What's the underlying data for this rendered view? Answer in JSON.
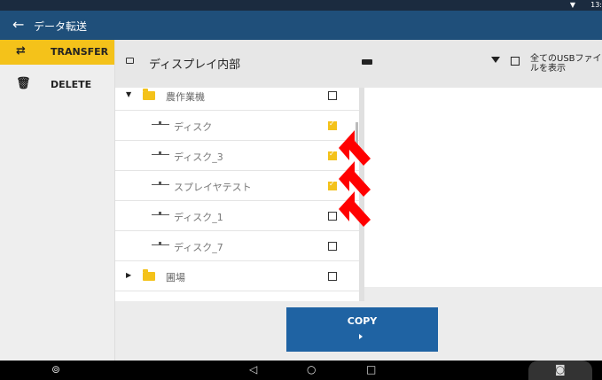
{
  "status": {
    "time": "13:"
  },
  "app": {
    "title": "データ転送"
  },
  "sidebar": {
    "items": [
      {
        "label": "TRANSFER",
        "icon": "swap-arrows-icon"
      },
      {
        "label": "DELETE",
        "icon": "trash-icon"
      }
    ]
  },
  "header": {
    "name": "ディスプレイ内部",
    "usb_label": "全てのUSBファイルを表示"
  },
  "list": {
    "rows": [
      {
        "type": "folder",
        "name": "農作業機",
        "expanded": true,
        "checked": false
      },
      {
        "type": "disk",
        "name": "ディスク",
        "checked": true
      },
      {
        "type": "disk",
        "name": "ディスク_3",
        "checked": true
      },
      {
        "type": "disk",
        "name": "スプレイヤテスト",
        "checked": true
      },
      {
        "type": "disk",
        "name": "ディスク_1",
        "checked": false
      },
      {
        "type": "disk",
        "name": "ディスク_7",
        "checked": false
      },
      {
        "type": "folder",
        "name": "圃場",
        "expanded": false,
        "checked": false
      }
    ]
  },
  "copy": {
    "label": "COPY"
  },
  "colors": {
    "accent": "#f4c21a",
    "appbar": "#1f4f7a",
    "button": "#1f63a3",
    "arrow": "#ff0000"
  }
}
